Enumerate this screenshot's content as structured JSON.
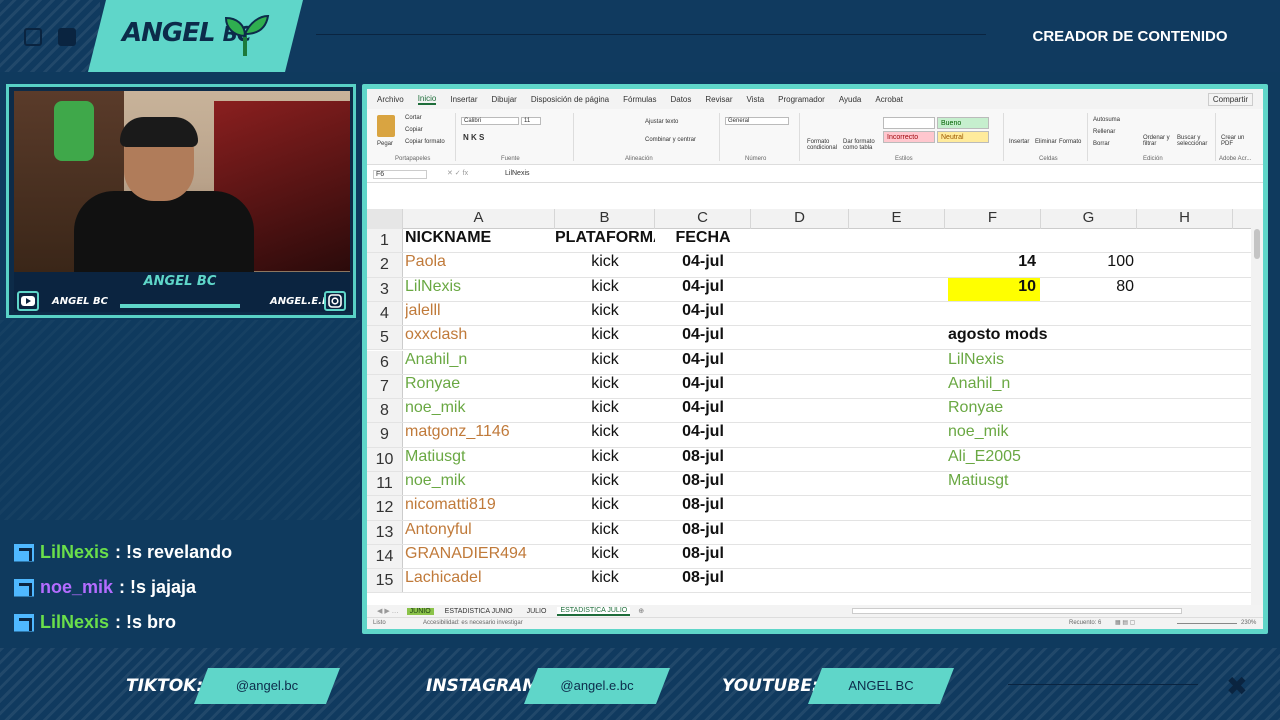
{
  "header": {
    "logo_main": "ANGEL",
    "logo_suffix": "BC",
    "tagline": "CREADOR DE CONTENIDO"
  },
  "webcam": {
    "name": "ANGEL BC",
    "youtube_handle": "ANGEL BC",
    "instagram_handle": "ANGEL.E.BC"
  },
  "chat": [
    {
      "user": "LilNexis",
      "message": ": !s revelando",
      "color": "#6adf4a"
    },
    {
      "user": "noe_mik",
      "message": ": !s jajaja",
      "color": "#b46cff"
    },
    {
      "user": "LilNexis",
      "message": ": !s bro",
      "color": "#6adf4a"
    }
  ],
  "excel": {
    "tabs": [
      "Archivo",
      "Inicio",
      "Insertar",
      "Dibujar",
      "Disposición de página",
      "Fórmulas",
      "Datos",
      "Revisar",
      "Vista",
      "Programador",
      "Ayuda",
      "Acrobat"
    ],
    "share_label": "Compartir",
    "ribbon": {
      "paste": "Pegar",
      "cut": "Cortar",
      "copy": "Copiar",
      "format_painter": "Copiar formato",
      "font_name": "Calibri",
      "font_size": "11",
      "wrap": "Ajustar texto",
      "merge": "Combinar y centrar",
      "number_format": "General",
      "cond_format": "Formato condicional",
      "format_table": "Dar formato como tabla",
      "style_normal": "Normal",
      "style_good": "Bueno",
      "style_bad": "Incorrecto",
      "style_neutral": "Neutral",
      "insert": "Insertar",
      "delete": "Eliminar",
      "format": "Formato",
      "autosum": "Autosuma",
      "fill": "Rellenar",
      "clear": "Borrar",
      "sort": "Ordenar y filtrar",
      "find": "Buscar y seleccionar",
      "pdf": "Crear un PDF",
      "groups": [
        "Portapapeles",
        "Fuente",
        "Alineación",
        "Número",
        "Estilos",
        "Celdas",
        "Edición",
        "Adobe Acr..."
      ]
    },
    "name_box": "F6",
    "formula": "LilNexis",
    "columns": [
      "A",
      "B",
      "C",
      "D",
      "E",
      "F",
      "G",
      "H"
    ],
    "header_row": {
      "a": "NICKNAME",
      "b": "PLATAFORMA",
      "c": "FECHA"
    },
    "rows": [
      {
        "n": "2",
        "a": "Paola",
        "b": "kick",
        "c": "04-jul",
        "f": "14",
        "g": "100"
      },
      {
        "n": "3",
        "a": "LilNexis",
        "b": "kick",
        "c": "04-jul",
        "f": "10",
        "g": "80"
      },
      {
        "n": "4",
        "a": "jalelll",
        "b": "kick",
        "c": "04-jul",
        "f": "",
        "g": ""
      },
      {
        "n": "5",
        "a": "oxxclash",
        "b": "kick",
        "c": "04-jul",
        "f": "agosto mods",
        "g": ""
      },
      {
        "n": "6",
        "a": "Anahil_n",
        "b": "kick",
        "c": "04-jul",
        "f": "LilNexis",
        "g": ""
      },
      {
        "n": "7",
        "a": "Ronyae",
        "b": "kick",
        "c": "04-jul",
        "f": "Anahil_n",
        "g": ""
      },
      {
        "n": "8",
        "a": "noe_mik",
        "b": "kick",
        "c": "04-jul",
        "f": "Ronyae",
        "g": ""
      },
      {
        "n": "9",
        "a": "matgonz_1146",
        "b": "kick",
        "c": "04-jul",
        "f": "noe_mik",
        "g": ""
      },
      {
        "n": "10",
        "a": "Matiusgt",
        "b": "kick",
        "c": "08-jul",
        "f": "Ali_E2005",
        "g": ""
      },
      {
        "n": "11",
        "a": "noe_mik",
        "b": "kick",
        "c": "08-jul",
        "f": "Matiusgt",
        "g": ""
      },
      {
        "n": "12",
        "a": "nicomatti819",
        "b": "kick",
        "c": "08-jul",
        "f": "",
        "g": ""
      },
      {
        "n": "13",
        "a": "Antonyful",
        "b": "kick",
        "c": "08-jul",
        "f": "",
        "g": ""
      },
      {
        "n": "14",
        "a": "GRANADIER494",
        "b": "kick",
        "c": "08-jul",
        "f": "",
        "g": ""
      },
      {
        "n": "15",
        "a": "Lachicadel",
        "b": "kick",
        "c": "08-jul",
        "f": "",
        "g": ""
      }
    ],
    "sheet_tabs": [
      "JUNIO",
      "ESTADISTICA JUNIO",
      "JULIO",
      "ESTADISTICA JULIO"
    ],
    "status_left": "Listo",
    "status_access": "Accesibilidad: es necesario investigar",
    "status_count": "Recuento: 6",
    "zoom": "230%"
  },
  "footer": {
    "tiktok_label": "TIKTOK:",
    "tiktok": "@angel.bc",
    "instagram_label": "INSTAGRAM:",
    "instagram": "@angel.e.bc",
    "youtube_label": "YOUTUBE:",
    "youtube": "ANGEL BC"
  }
}
